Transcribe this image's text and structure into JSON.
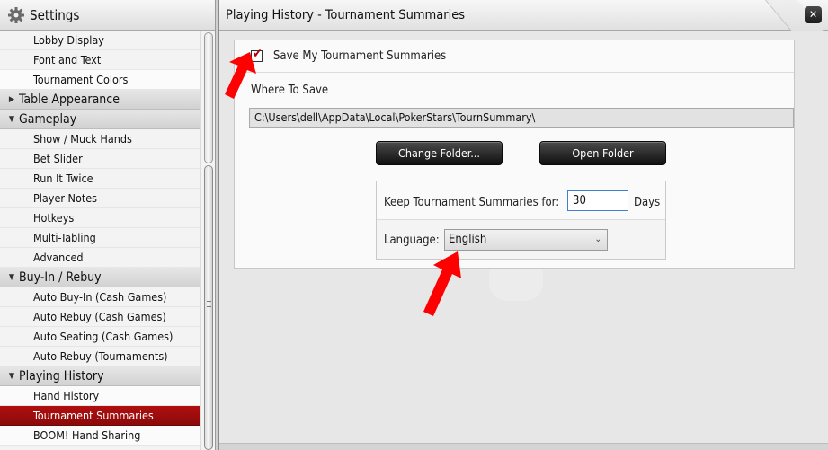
{
  "sidebar": {
    "title": "Settings",
    "items": [
      {
        "type": "item",
        "label": "Lobby Display",
        "name": "sidebar-item-lobby-display"
      },
      {
        "type": "item",
        "label": "Font and Text",
        "name": "sidebar-item-font-and-text"
      },
      {
        "type": "item",
        "label": "Tournament Colors",
        "name": "sidebar-item-tournament-colors",
        "light": true
      },
      {
        "type": "category",
        "label": "Table Appearance",
        "expanded": false,
        "name": "sidebar-category-table-appearance"
      },
      {
        "type": "category",
        "label": "Gameplay",
        "expanded": true,
        "name": "sidebar-category-gameplay"
      },
      {
        "type": "item",
        "label": "Show / Muck Hands",
        "name": "sidebar-item-show-muck-hands"
      },
      {
        "type": "item",
        "label": "Bet Slider",
        "name": "sidebar-item-bet-slider"
      },
      {
        "type": "item",
        "label": "Run It Twice",
        "name": "sidebar-item-run-it-twice"
      },
      {
        "type": "item",
        "label": "Player Notes",
        "name": "sidebar-item-player-notes"
      },
      {
        "type": "item",
        "label": "Hotkeys",
        "name": "sidebar-item-hotkeys"
      },
      {
        "type": "item",
        "label": "Multi-Tabling",
        "name": "sidebar-item-multi-tabling"
      },
      {
        "type": "item",
        "label": "Advanced",
        "name": "sidebar-item-advanced"
      },
      {
        "type": "category",
        "label": "Buy-In / Rebuy",
        "expanded": true,
        "name": "sidebar-category-buy-in-rebuy"
      },
      {
        "type": "item",
        "label": "Auto Buy-In (Cash Games)",
        "name": "sidebar-item-auto-buy-in"
      },
      {
        "type": "item",
        "label": "Auto Rebuy (Cash Games)",
        "name": "sidebar-item-auto-rebuy-cash"
      },
      {
        "type": "item",
        "label": "Auto Seating (Cash Games)",
        "name": "sidebar-item-auto-seating"
      },
      {
        "type": "item",
        "label": "Auto Rebuy (Tournaments)",
        "name": "sidebar-item-auto-rebuy-tournaments"
      },
      {
        "type": "category",
        "label": "Playing History",
        "expanded": true,
        "name": "sidebar-category-playing-history"
      },
      {
        "type": "item",
        "label": "Hand History",
        "name": "sidebar-item-hand-history",
        "light": true
      },
      {
        "type": "item",
        "label": "Tournament Summaries",
        "name": "sidebar-item-tournament-summaries",
        "active": true
      },
      {
        "type": "item",
        "label": "BOOM! Hand Sharing",
        "name": "sidebar-item-boom-hand-sharing",
        "light": true
      }
    ]
  },
  "main": {
    "title": "Playing History - Tournament Summaries",
    "save_checkbox": {
      "label": "Save My Tournament Summaries",
      "checked": true
    },
    "where_label": "Where To Save",
    "path_value": "C:\\Users\\dell\\AppData\\Local\\PokerStars\\TournSummary\\",
    "change_folder_label": "Change Folder...",
    "open_folder_label": "Open Folder",
    "keep_label": "Keep Tournament Summaries for:",
    "keep_value": "30",
    "days_label": "Days",
    "language_label": "Language:",
    "language_value": "English"
  },
  "colors": {
    "active_item": "#a00d0d",
    "annotation_arrow": "#ff0000"
  },
  "icons": {
    "settings": "gear-icon",
    "close": "close-icon",
    "dropdown": "chevron-down-icon",
    "collapsed": "triangle-right-icon",
    "expanded": "triangle-down-icon"
  }
}
